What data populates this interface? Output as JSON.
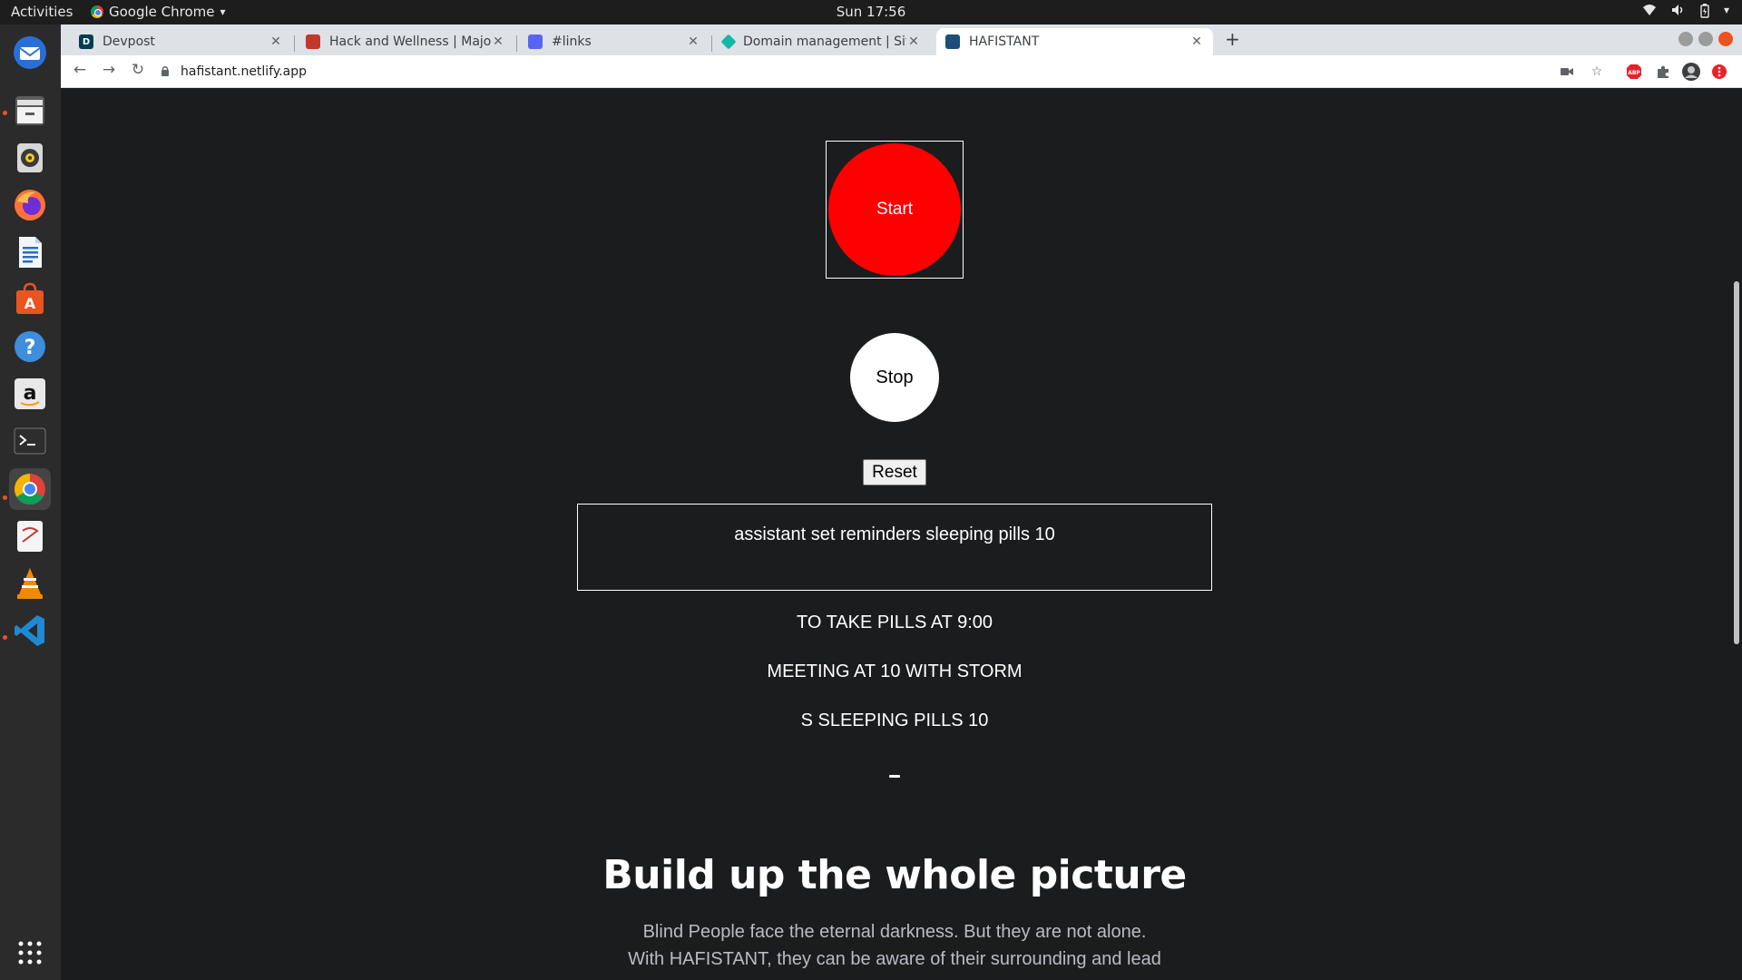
{
  "os": {
    "activities_label": "Activities",
    "app_name": "Google Chrome",
    "app_menu_arrow": "▾",
    "clock": "Sun 17:56"
  },
  "browser": {
    "tabs": [
      {
        "title": "Devpost",
        "favicon": "D",
        "favicon_color": "#003e54"
      },
      {
        "title": "Hack and Wellness | Majo",
        "favicon": "",
        "favicon_color": "#c0392b"
      },
      {
        "title": "#links",
        "favicon": "",
        "favicon_color": "#5865f2"
      },
      {
        "title": "Domain management | Sit",
        "favicon": "",
        "favicon_color": "#14b8a6"
      },
      {
        "title": "HAFISTANT",
        "favicon": "",
        "favicon_color": "#1a4f7a"
      }
    ],
    "new_tab_symbol": "+",
    "url": "hafistant.netlify.app"
  },
  "app": {
    "start_label": "Start",
    "stop_label": "Stop",
    "reset_label": "Reset",
    "transcript": "assistant set reminders sleeping pills 10",
    "reminders": [
      "TO TAKE PILLS AT 9:00",
      "MEETING AT 10 WITH STORM",
      "S SLEEPING PILLS 10"
    ],
    "section_heading": "Build up the whole picture",
    "section_body_lines": [
      "Blind People face the eternal darkness. But they are not alone.",
      "With HAFISTANT, they can be aware of their surrounding and lead"
    ],
    "colors": {
      "page_background": "#1b1c1e",
      "start_button": "#ff0000",
      "stop_button": "#ffffff",
      "body_text_muted": "#b8bcc3"
    }
  },
  "dock": {
    "icons": [
      "thunderbird-icon",
      "files-icon",
      "rhythmbox-icon",
      "firefox-icon",
      "writer-icon",
      "software-icon",
      "help-icon",
      "amazon-icon",
      "terminal-icon",
      "chrome-icon",
      "text-editor-icon",
      "vlc-icon",
      "vscode-icon",
      "show-apps-icon"
    ]
  }
}
